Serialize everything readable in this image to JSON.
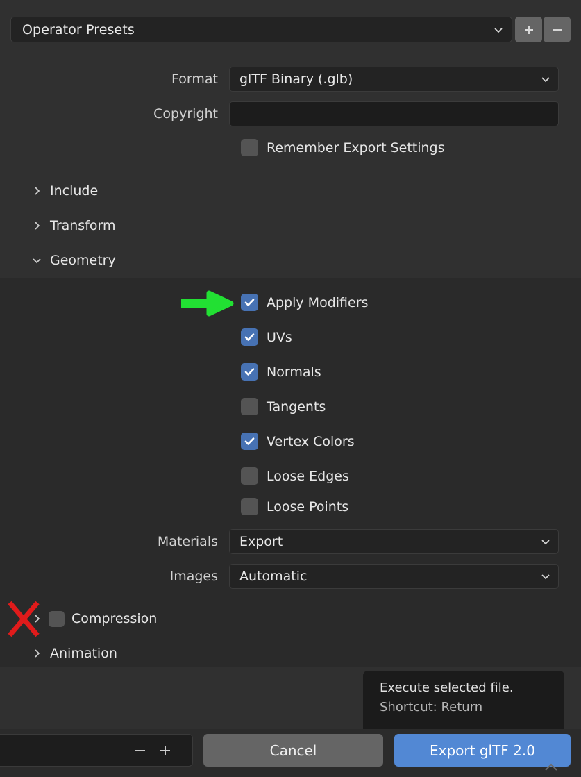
{
  "preset": {
    "value": "Operator Presets",
    "chevron_icon": "chevron-down-icon",
    "add_label": "+",
    "remove_label": "−"
  },
  "properties": {
    "format": {
      "label": "Format",
      "value": "glTF Binary (.glb)"
    },
    "copyright": {
      "label": "Copyright",
      "value": "",
      "placeholder": ""
    },
    "remember": {
      "label": "Remember Export Settings",
      "checked": false
    }
  },
  "sections": [
    {
      "name": "include",
      "label": "Include",
      "expanded": false
    },
    {
      "name": "transform",
      "label": "Transform",
      "expanded": false
    },
    {
      "name": "geometry",
      "label": "Geometry",
      "expanded": true
    }
  ],
  "geometry": {
    "checkboxes": [
      {
        "name": "apply-modifiers",
        "label": "Apply Modifiers",
        "checked": true
      },
      {
        "name": "uvs",
        "label": "UVs",
        "checked": true
      },
      {
        "name": "normals",
        "label": "Normals",
        "checked": true
      },
      {
        "name": "tangents",
        "label": "Tangents",
        "checked": false
      },
      {
        "name": "vertex-colors",
        "label": "Vertex Colors",
        "checked": true
      },
      {
        "name": "loose-edges",
        "label": "Loose Edges",
        "checked": false
      },
      {
        "name": "loose-points",
        "label": "Loose Points",
        "checked": false
      }
    ],
    "materials": {
      "label": "Materials",
      "value": "Export"
    },
    "images": {
      "label": "Images",
      "value": "Automatic"
    }
  },
  "footer_sections": [
    {
      "name": "compression",
      "label": "Compression",
      "expanded": false,
      "checked": false
    },
    {
      "name": "animation",
      "label": "Animation",
      "expanded": false
    }
  ],
  "tooltip": {
    "line1": "Execute selected file.",
    "line2": "Shortcut: Return"
  },
  "bottom": {
    "decrement_label": "−",
    "increment_label": "+",
    "cancel_label": "Cancel",
    "export_label": "Export glTF 2.0",
    "resize_icon": "chevron-up-icon"
  },
  "annotations": {
    "green_arrow": {
      "icon": "green-arrow-annotation",
      "points_to": "Apply Modifiers",
      "color": "#22e033"
    },
    "red_x": {
      "icon": "red-x-annotation",
      "marks": "Compression",
      "color": "#e01b1b"
    }
  },
  "colors": {
    "background": "#303030",
    "panel_body": "#2a2a2a",
    "checkbox_on": "#4772b3",
    "checkbox_off": "#545454",
    "field": "#232323",
    "button_gray": "#656565",
    "button_blue": "#5288d4"
  }
}
